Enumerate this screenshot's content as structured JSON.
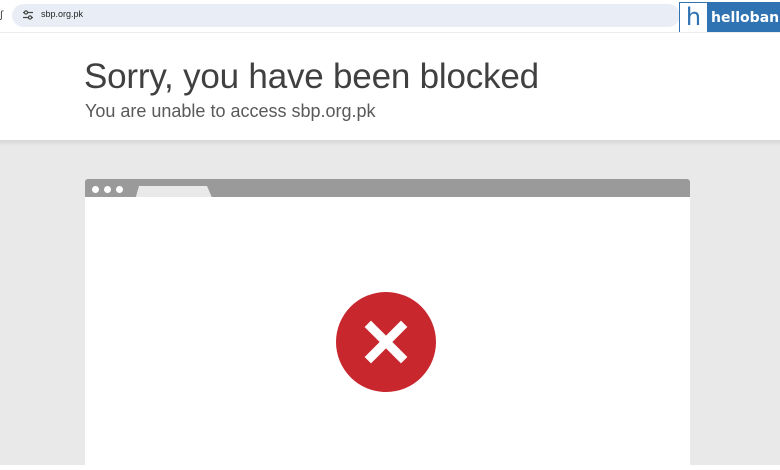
{
  "browser": {
    "url": "sbp.org.pk",
    "edge_glyph": "ʃ"
  },
  "logo": {
    "mark": "h",
    "name": "hellobank",
    "color": "#2f73b3"
  },
  "page": {
    "title": "Sorry, you have been blocked",
    "subtitle": "You are unable to access sbp.org.pk"
  },
  "illustration": {
    "error_icon": "x-circle-icon",
    "error_color": "#c8272d",
    "frame_color": "#9a9a9a"
  }
}
